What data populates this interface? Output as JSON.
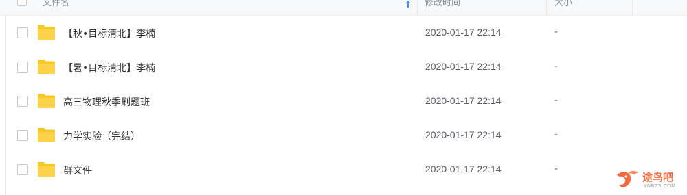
{
  "header": {
    "name_label": "文件名",
    "modified_label": "修改时间",
    "size_label": "大小"
  },
  "files": [
    {
      "name": "【秋•目标清北】李楠",
      "modified": "2020-01-17 22:14",
      "size": "-"
    },
    {
      "name": "【暑•目标清北】李楠",
      "modified": "2020-01-17 22:14",
      "size": "-"
    },
    {
      "name": "高三物理秋季刷题班",
      "modified": "2020-01-17 22:14",
      "size": "-"
    },
    {
      "name": "力学实验（完结）",
      "modified": "2020-01-17 22:14",
      "size": "-"
    },
    {
      "name": "群文件",
      "modified": "2020-01-17 22:14",
      "size": "-"
    }
  ],
  "watermark": {
    "text": "途鸟吧",
    "sub": "YNBZS.COM"
  },
  "colors": {
    "folder": "#f8c822",
    "sort_arrow": "#3b8cff",
    "watermark": "#f26a3d"
  },
  "icons": {
    "sort": "arrow-up-icon",
    "folder": "folder-icon"
  }
}
